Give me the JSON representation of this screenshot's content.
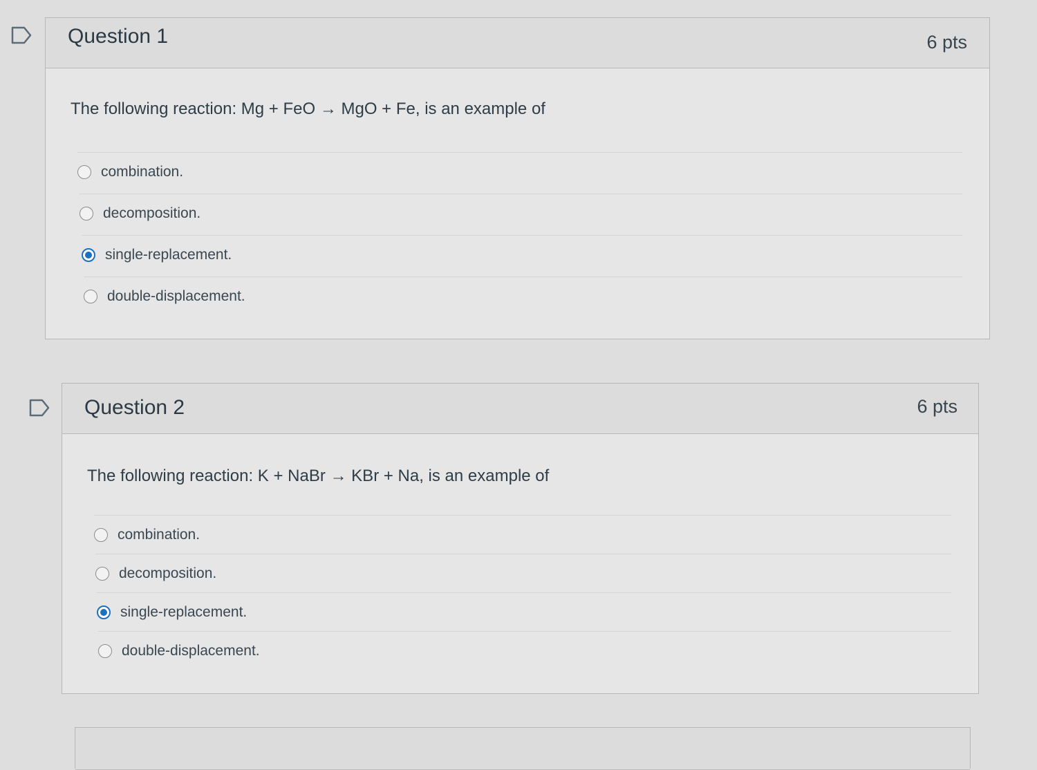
{
  "questions": [
    {
      "title": "Question 1",
      "points": "6 pts",
      "text": "The following reaction: Mg + FeO → MgO + Fe, is an example of",
      "answers": [
        {
          "label": "combination.",
          "selected": false
        },
        {
          "label": "decomposition.",
          "selected": false
        },
        {
          "label": "single-replacement.",
          "selected": true
        },
        {
          "label": "double-displacement.",
          "selected": false
        }
      ]
    },
    {
      "title": "Question 2",
      "points": "6 pts",
      "text": "The following reaction: K + NaBr → KBr + Na, is an example of",
      "answers": [
        {
          "label": "combination.",
          "selected": false
        },
        {
          "label": "decomposition.",
          "selected": false
        },
        {
          "label": "single-replacement.",
          "selected": true
        },
        {
          "label": "double-displacement.",
          "selected": false
        }
      ]
    }
  ],
  "colors": {
    "accent": "#1d6fc0",
    "page_background": "#dedede",
    "card_header": "#dcdcdc"
  }
}
